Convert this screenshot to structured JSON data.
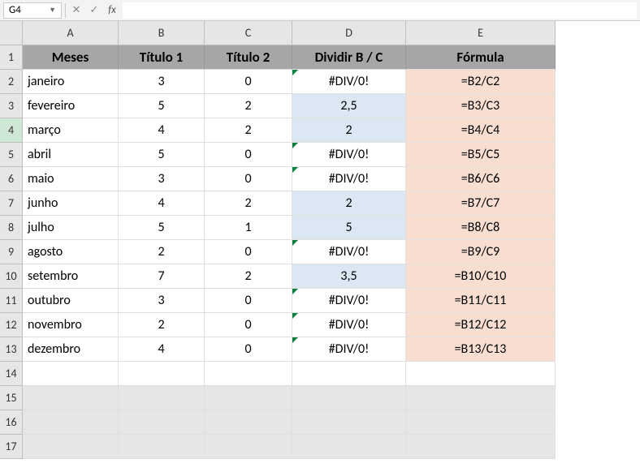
{
  "name_box": "G4",
  "formula_input": "",
  "columns": [
    "A",
    "B",
    "C",
    "D",
    "E"
  ],
  "headers": {
    "A": "Meses",
    "B": "Título 1",
    "C": "Título 2",
    "D": "Dividir B / C",
    "E": "Fórmula"
  },
  "rows": [
    {
      "n": 2,
      "A": "janeiro",
      "B": "3",
      "C": "0",
      "D": "#DIV/0!",
      "E": "=B2/C2",
      "err": true,
      "blue": false
    },
    {
      "n": 3,
      "A": "fevereiro",
      "B": "5",
      "C": "2",
      "D": "2,5",
      "E": "=B3/C3",
      "err": false,
      "blue": true
    },
    {
      "n": 4,
      "A": "março",
      "B": "4",
      "C": "2",
      "D": "2",
      "E": "=B4/C4",
      "err": false,
      "blue": true
    },
    {
      "n": 5,
      "A": "abril",
      "B": "5",
      "C": "0",
      "D": "#DIV/0!",
      "E": "=B5/C5",
      "err": true,
      "blue": false
    },
    {
      "n": 6,
      "A": "maio",
      "B": "3",
      "C": "0",
      "D": "#DIV/0!",
      "E": "=B6/C6",
      "err": true,
      "blue": false
    },
    {
      "n": 7,
      "A": "junho",
      "B": "4",
      "C": "2",
      "D": "2",
      "E": "=B7/C7",
      "err": false,
      "blue": true
    },
    {
      "n": 8,
      "A": "julho",
      "B": "5",
      "C": "1",
      "D": "5",
      "E": "=B8/C8",
      "err": false,
      "blue": true
    },
    {
      "n": 9,
      "A": "agosto",
      "B": "2",
      "C": "0",
      "D": "#DIV/0!",
      "E": "=B9/C9",
      "err": true,
      "blue": false
    },
    {
      "n": 10,
      "A": "setembro",
      "B": "7",
      "C": "2",
      "D": "3,5",
      "E": "=B10/C10",
      "err": false,
      "blue": true
    },
    {
      "n": 11,
      "A": "outubro",
      "B": "3",
      "C": "0",
      "D": "#DIV/0!",
      "E": "=B11/C11",
      "err": true,
      "blue": false
    },
    {
      "n": 12,
      "A": "novembro",
      "B": "2",
      "C": "0",
      "D": "#DIV/0!",
      "E": "=B12/C12",
      "err": true,
      "blue": false
    },
    {
      "n": 13,
      "A": "dezembro",
      "B": "4",
      "C": "0",
      "D": "#DIV/0!",
      "E": "=B13/C13",
      "err": true,
      "blue": false
    }
  ],
  "empty_rows": [
    14,
    15,
    16,
    17
  ],
  "active_row": 4,
  "chart_data": {
    "type": "table",
    "title": "Dividir B / C",
    "columns": [
      "Meses",
      "Título 1",
      "Título 2",
      "Dividir B / C",
      "Fórmula"
    ],
    "data": [
      [
        "janeiro",
        3,
        0,
        "#DIV/0!",
        "=B2/C2"
      ],
      [
        "fevereiro",
        5,
        2,
        2.5,
        "=B3/C3"
      ],
      [
        "março",
        4,
        2,
        2,
        "=B4/C4"
      ],
      [
        "abril",
        5,
        0,
        "#DIV/0!",
        "=B5/C5"
      ],
      [
        "maio",
        3,
        0,
        "#DIV/0!",
        "=B6/C6"
      ],
      [
        "junho",
        4,
        2,
        2,
        "=B7/C7"
      ],
      [
        "julho",
        5,
        1,
        5,
        "=B8/C8"
      ],
      [
        "agosto",
        2,
        0,
        "#DIV/0!",
        "=B9/C9"
      ],
      [
        "setembro",
        7,
        2,
        3.5,
        "=B10/C10"
      ],
      [
        "outubro",
        3,
        0,
        "#DIV/0!",
        "=B11/C11"
      ],
      [
        "novembro",
        2,
        0,
        "#DIV/0!",
        "=B12/C12"
      ],
      [
        "dezembro",
        4,
        0,
        "#DIV/0!",
        "=B13/C13"
      ]
    ]
  }
}
